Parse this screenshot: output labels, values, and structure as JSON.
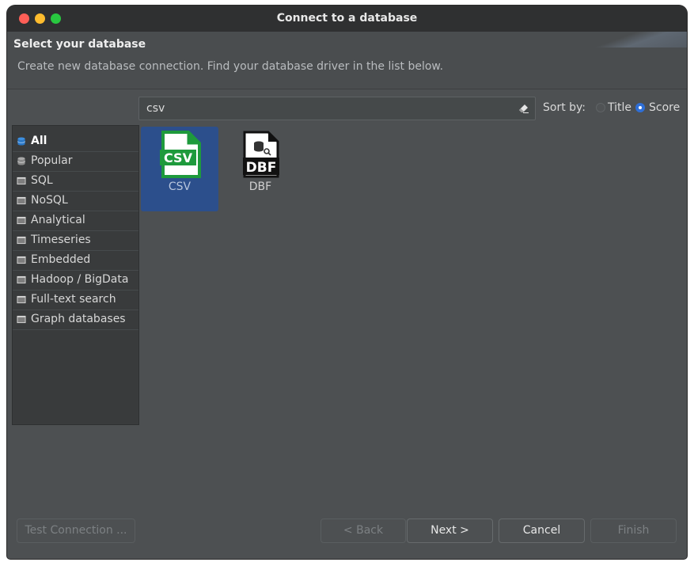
{
  "window": {
    "title": "Connect to a database"
  },
  "header": {
    "title": "Select your database",
    "description": "Create new database connection. Find your database driver in the list below."
  },
  "search": {
    "value": "csv",
    "clear_icon": "eraser-icon"
  },
  "sort": {
    "label": "Sort by:",
    "options": [
      {
        "label": "Title",
        "selected": false
      },
      {
        "label": "Score",
        "selected": true
      }
    ]
  },
  "categories": [
    {
      "label": "All",
      "icon": "database-icon",
      "active": true
    },
    {
      "label": "Popular",
      "icon": "database-icon",
      "active": false
    },
    {
      "label": "SQL",
      "icon": "folder-icon",
      "active": false
    },
    {
      "label": "NoSQL",
      "icon": "folder-icon",
      "active": false
    },
    {
      "label": "Analytical",
      "icon": "folder-icon",
      "active": false
    },
    {
      "label": "Timeseries",
      "icon": "folder-icon",
      "active": false
    },
    {
      "label": "Embedded",
      "icon": "folder-icon",
      "active": false
    },
    {
      "label": "Hadoop / BigData",
      "icon": "folder-icon",
      "active": false
    },
    {
      "label": "Full-text search",
      "icon": "folder-icon",
      "active": false
    },
    {
      "label": "Graph databases",
      "icon": "folder-icon",
      "active": false
    }
  ],
  "drivers": [
    {
      "label": "CSV",
      "icon": "csv-file-icon",
      "icon_text": "CSV",
      "selected": true
    },
    {
      "label": "DBF",
      "icon": "dbf-file-icon",
      "icon_text": "DBF",
      "selected": false
    }
  ],
  "buttons": {
    "test_connection": "Test Connection ...",
    "back": "< Back",
    "next": "Next >",
    "cancel": "Cancel",
    "finish": "Finish"
  },
  "colors": {
    "selection": "#2c4f8c",
    "csv_green": "#1e9a3c",
    "radio_accent": "#2f6fd6"
  }
}
